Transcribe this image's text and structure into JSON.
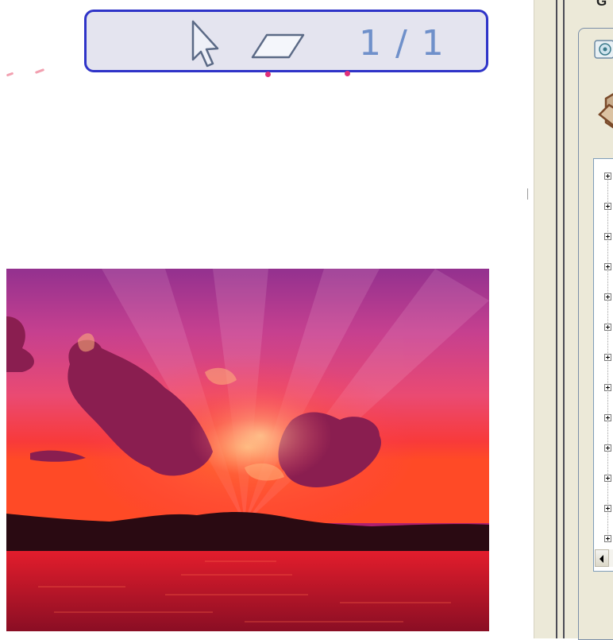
{
  "toolbar": {
    "page_indicator": "1 / 1",
    "cursor_icon": "cursor-arrow-icon",
    "shape_icon": "parallelogram-icon",
    "border_color": "#2f34c8",
    "background_color": "#e4e4ef"
  },
  "photo": {
    "description_icon": "sunset-image",
    "sky_top": "#9b2f8f",
    "sky_mid": "#e0407a",
    "horizon": "#ff3b1e",
    "water": "#c8142a"
  },
  "right_panel": {
    "title": "G",
    "tree_expanders": [
      "+",
      "+",
      "+",
      "+",
      "+",
      "+",
      "+",
      "+",
      "+",
      "+",
      "+",
      "+",
      "+"
    ]
  }
}
